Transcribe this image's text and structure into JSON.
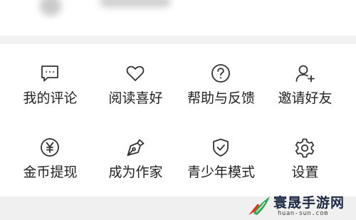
{
  "menu": {
    "items": [
      {
        "label": "我的评论",
        "icon": "comment-icon"
      },
      {
        "label": "阅读喜好",
        "icon": "heart-icon"
      },
      {
        "label": "帮助与反馈",
        "icon": "help-icon"
      },
      {
        "label": "邀请好友",
        "icon": "add-user-icon"
      },
      {
        "label": "金币提现",
        "icon": "yuan-coin-icon"
      },
      {
        "label": "成为作家",
        "icon": "pen-nib-icon"
      },
      {
        "label": "青少年模式",
        "icon": "shield-check-icon"
      },
      {
        "label": "设置",
        "icon": "gear-icon"
      }
    ]
  },
  "watermark": {
    "title": "寰晟手游网",
    "subtitle": "huan-sun.com"
  },
  "colors": {
    "icon_stroke": "#333333",
    "text": "#222222",
    "separator": "#f2f2f2",
    "watermark_red": "#e8321e",
    "watermark_green": "#33a852"
  }
}
